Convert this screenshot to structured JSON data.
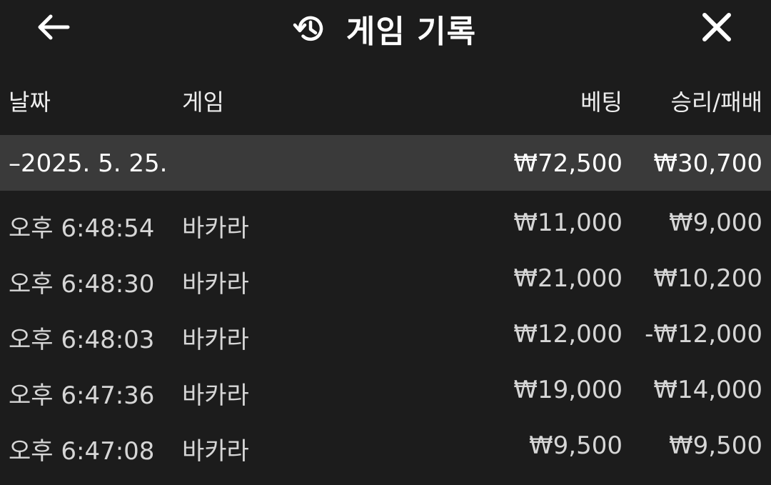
{
  "header": {
    "title": "게임 기록",
    "back_icon": "arrow-left-icon",
    "history_icon": "history-icon",
    "close_icon": "close-icon"
  },
  "columns": {
    "date": "날짜",
    "game": "게임",
    "bet": "베팅",
    "result": "승리/패배"
  },
  "group": {
    "date": "–2025. 5. 25.",
    "bet_total": "₩72,500",
    "result_total": "₩30,700"
  },
  "rows": [
    {
      "time": "오후 6:48:54",
      "game": "바카라",
      "bet": "₩11,000",
      "result": "₩9,000"
    },
    {
      "time": "오후 6:48:30",
      "game": "바카라",
      "bet": "₩21,000",
      "result": "₩10,200"
    },
    {
      "time": "오후 6:48:03",
      "game": "바카라",
      "bet": "₩12,000",
      "result": "-₩12,000"
    },
    {
      "time": "오후 6:47:36",
      "game": "바카라",
      "bet": "₩19,000",
      "result": "₩14,000"
    },
    {
      "time": "오후 6:47:08",
      "game": "바카라",
      "bet": "₩9,500",
      "result": "₩9,500"
    }
  ],
  "colors": {
    "background": "#1c1c1c",
    "group_row": "#3a3a3a",
    "text": "#d6d6d6",
    "title": "#ffffff"
  }
}
